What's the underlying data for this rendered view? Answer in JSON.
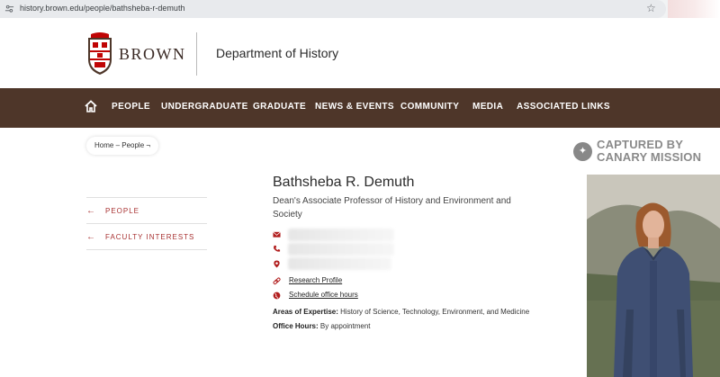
{
  "browser": {
    "url": "history.brown.edu/people/bathsheba-r-demuth"
  },
  "header": {
    "brand": "BROWN",
    "department": "Department of History"
  },
  "nav": {
    "items": [
      "PEOPLE",
      "UNDERGRADUATE",
      "GRADUATE",
      "NEWS & EVENTS",
      "COMMUNITY",
      "MEDIA",
      "ASSOCIATED LINKS"
    ]
  },
  "breadcrumb": "Home – People ¬",
  "watermark": {
    "line1": "CAPTURED BY",
    "line2": "CANARY MISSION"
  },
  "sidebar": {
    "links": [
      "PEOPLE",
      "FACULTY INTERESTS"
    ]
  },
  "profile": {
    "name": "Bathsheba R. Demuth",
    "title": "Dean's Associate Professor of History and Environment and Society",
    "research_profile": "Research Profile",
    "schedule": "Schedule office hours",
    "expertise_label": "Areas of Expertise:",
    "expertise_value": "History of Science, Technology, Environment, and Medicine",
    "office_label": "Office Hours:",
    "office_value": "By appointment"
  },
  "colors": {
    "nav_bg": "#4e3629",
    "accent_red": "#b11d1d"
  }
}
